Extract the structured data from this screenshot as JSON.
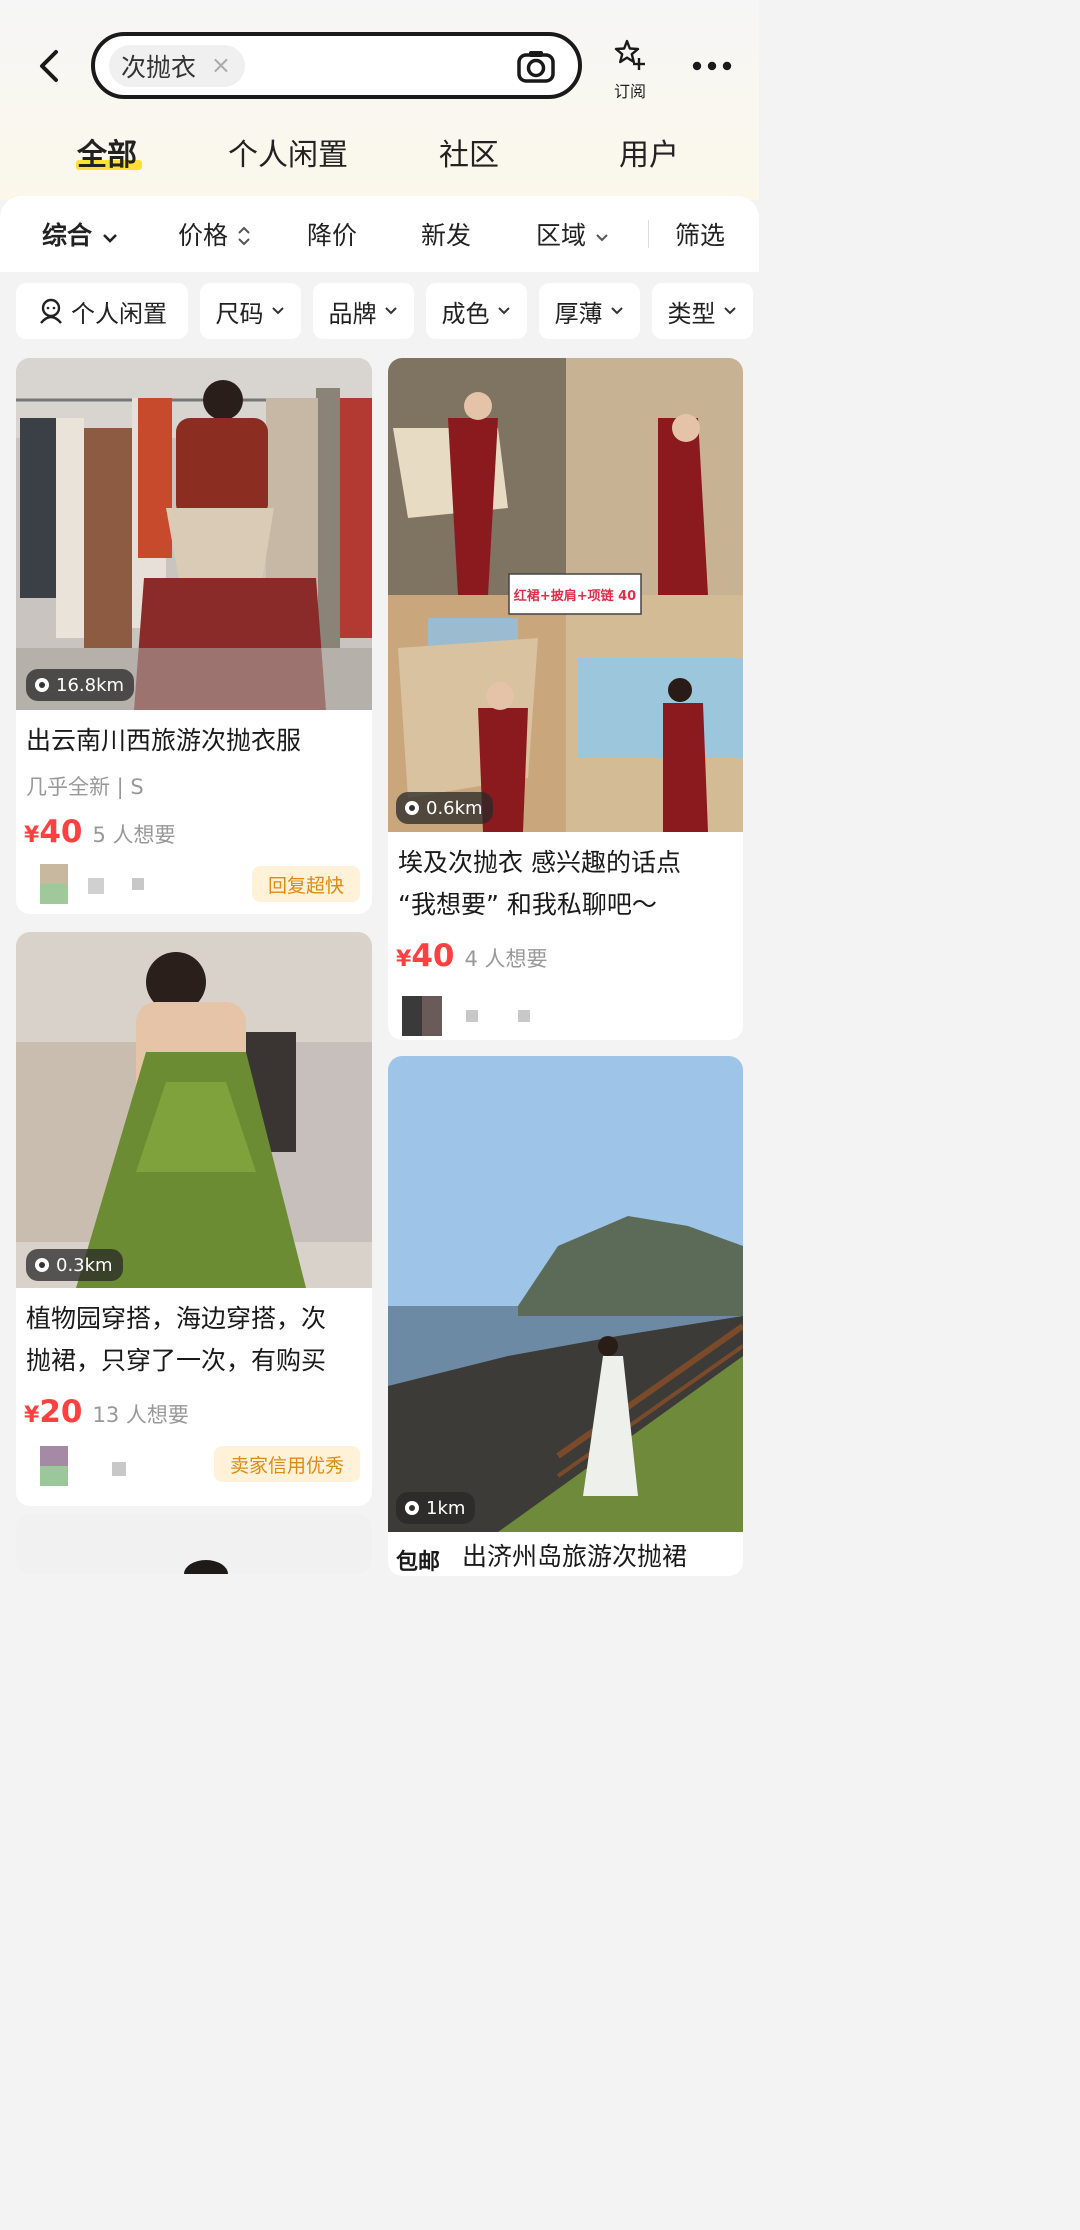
{
  "header": {
    "search_chip": "次抛衣",
    "chip_close": "×",
    "subscribe_label": "订阅",
    "icons": [
      "back-arrow-icon",
      "close-icon",
      "camera-icon",
      "subscribe-icon",
      "more-icon"
    ]
  },
  "tabs": [
    {
      "label": "全部",
      "active": true
    },
    {
      "label": "个人闲置",
      "active": false
    },
    {
      "label": "社区",
      "active": false
    },
    {
      "label": "用户",
      "active": false
    }
  ],
  "filters": [
    {
      "label": "综合",
      "icon": "chevron-down-icon"
    },
    {
      "label": "价格",
      "icon": "sort-updown-icon"
    },
    {
      "label": "降价"
    },
    {
      "label": "新发"
    },
    {
      "label": "区域",
      "icon": "chevron-down-icon"
    },
    {
      "label": "筛选"
    }
  ],
  "chips": [
    {
      "label": "个人闲置",
      "icon": "person-icon"
    },
    {
      "label": "尺码",
      "icon": "chevron-down-icon"
    },
    {
      "label": "品牌",
      "icon": "chevron-down-icon"
    },
    {
      "label": "成色",
      "icon": "chevron-down-icon"
    },
    {
      "label": "厚薄",
      "icon": "chevron-down-icon"
    },
    {
      "label": "类型",
      "icon": "chevron-down-icon"
    }
  ],
  "colors": {
    "price": "#ff4040",
    "tab_underline": "#ffe033",
    "badge_bg": "#fff2d9",
    "badge_text": "#e08a10"
  },
  "items": [
    {
      "distance": "16.8km",
      "title": "出云南川西旅游次抛衣服",
      "condition": "几乎全新 | S",
      "currency": "¥",
      "price": "40",
      "want": "5 人想要",
      "badge": "回复超快"
    },
    {
      "distance": "0.6km",
      "overlay_text": "红裙+披肩+项链 40",
      "title_line1": "埃及次抛衣 感兴趣的话点",
      "title_line2": "“我想要” 和我私聊吧～",
      "currency": "¥",
      "price": "40",
      "want": "4 人想要"
    },
    {
      "distance": "0.3km",
      "title_line1": "植物园穿搭，海边穿搭，次",
      "title_line2": "抛裙，只穿了一次，有购买",
      "currency": "¥",
      "price": "20",
      "want": "13 人想要",
      "badge": "卖家信用优秀"
    },
    {
      "distance": "1km",
      "tag": "包邮",
      "title": "出济州岛旅游次抛裙"
    }
  ]
}
